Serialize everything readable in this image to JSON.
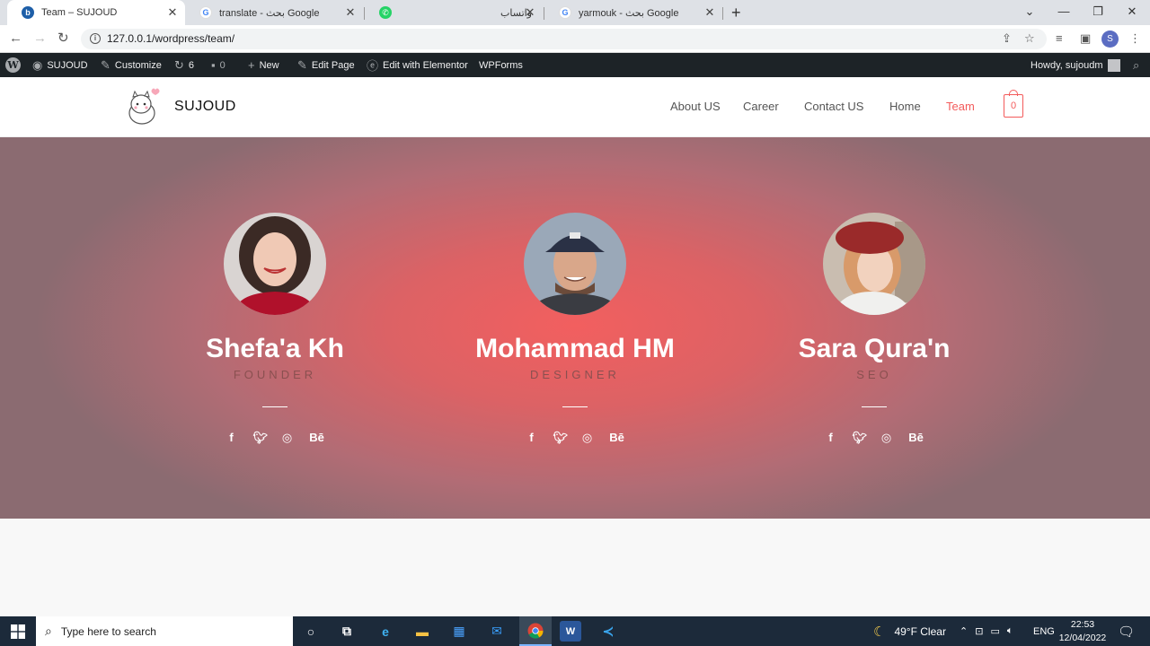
{
  "browser": {
    "tabs": [
      {
        "title": "Team – SUJOUD",
        "favicon": "wordpress-site-icon"
      },
      {
        "title": "translate - بحث Google",
        "favicon": "google-icon"
      },
      {
        "title": "واتساب",
        "favicon": "whatsapp-icon"
      },
      {
        "title": "yarmouk - بحث Google",
        "favicon": "google-icon"
      }
    ],
    "url": "127.0.0.1/wordpress/team/",
    "profile_initial": "S"
  },
  "wp_admin_bar": {
    "site_name": "SUJOUD",
    "customize": "Customize",
    "updates_count": "6",
    "comments_count": "0",
    "new_label": "New",
    "edit_page": "Edit Page",
    "edit_elementor": "Edit with Elementor",
    "wpforms": "WPForms",
    "howdy": "Howdy, sujoudm"
  },
  "site": {
    "brand": "SUJOUD",
    "menu": [
      "About US",
      "Career",
      "Contact US",
      "Home",
      "Team"
    ],
    "active_menu": "Team",
    "cart_count": "0",
    "accent_color": "#f35b5b"
  },
  "team": [
    {
      "name": "Shefa'a Kh",
      "role": "FOUNDER"
    },
    {
      "name": "Mohammad HM",
      "role": "DESIGNER"
    },
    {
      "name": "Sara Qura'n",
      "role": "SEO"
    }
  ],
  "social_icons": [
    "facebook-icon",
    "twitter-icon",
    "dribbble-icon",
    "behance-icon"
  ],
  "taskbar": {
    "search_placeholder": "Type here to search",
    "weather": "49°F  Clear",
    "language": "ENG",
    "time": "22:53",
    "date": "12/04/2022"
  }
}
